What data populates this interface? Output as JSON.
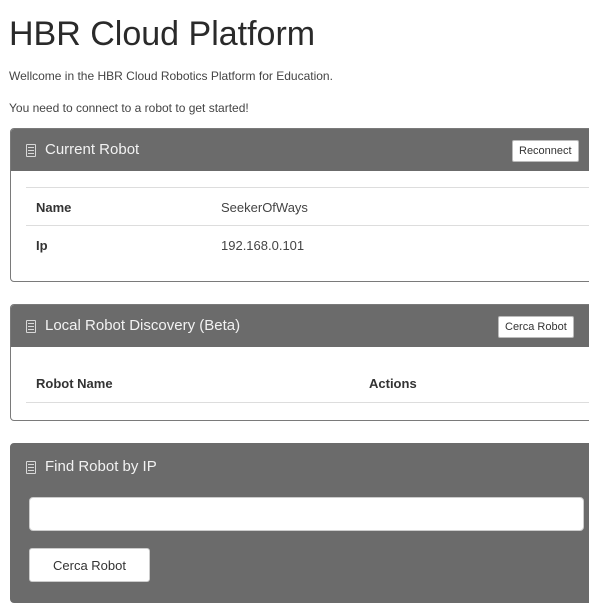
{
  "header": {
    "title": "HBR Cloud Platform",
    "welcome": "Wellcome in the HBR Cloud Robotics Platform for Education.",
    "instruction": "You need to connect to a robot to get started!"
  },
  "current_robot": {
    "title": "Current Robot",
    "icon": "book-icon",
    "reconnect_label": "Reconnect",
    "rows": [
      {
        "key": "Name",
        "value": "SeekerOfWays"
      },
      {
        "key": "Ip",
        "value": "192.168.0.101"
      }
    ]
  },
  "discovery": {
    "title": "Local Robot Discovery (Beta)",
    "icon": "book-icon",
    "search_label": "Cerca Robot",
    "columns": [
      "Robot Name",
      "Actions"
    ]
  },
  "find_by_ip": {
    "title": "Find Robot by IP",
    "icon": "book-icon",
    "input_value": "",
    "input_placeholder": "",
    "search_label": "Cerca Robot"
  },
  "colors": {
    "panel_header": "#6b6b6b",
    "panel_border": "#7a7a7a",
    "text": "#333333"
  }
}
